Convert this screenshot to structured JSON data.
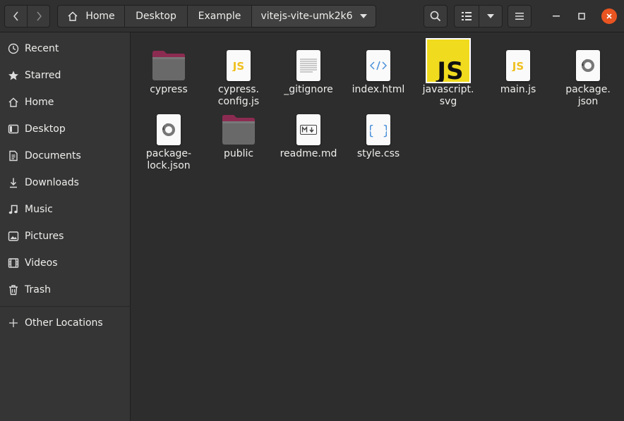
{
  "header": {
    "breadcrumbs": [
      "Home",
      "Desktop",
      "Example",
      "vitejs-vite-umk2k6"
    ]
  },
  "sidebar": {
    "items": [
      {
        "label": "Recent",
        "icon": "clock-icon"
      },
      {
        "label": "Starred",
        "icon": "star-icon"
      },
      {
        "label": "Home",
        "icon": "home-icon"
      },
      {
        "label": "Desktop",
        "icon": "desktop-icon"
      },
      {
        "label": "Documents",
        "icon": "documents-icon"
      },
      {
        "label": "Downloads",
        "icon": "downloads-icon"
      },
      {
        "label": "Music",
        "icon": "music-icon"
      },
      {
        "label": "Pictures",
        "icon": "pictures-icon"
      },
      {
        "label": "Videos",
        "icon": "videos-icon"
      },
      {
        "label": "Trash",
        "icon": "trash-icon"
      }
    ],
    "other_locations": "Other Locations"
  },
  "files": [
    {
      "name": "cypress",
      "type": "folder"
    },
    {
      "name": "cypress.\nconfig.js",
      "type": "js"
    },
    {
      "name": "_gitignore",
      "type": "text"
    },
    {
      "name": "index.html",
      "type": "html"
    },
    {
      "name": "javascript.\nsvg",
      "type": "svg-js",
      "selected": true
    },
    {
      "name": "main.js",
      "type": "js"
    },
    {
      "name": "package.\njson",
      "type": "json"
    },
    {
      "name": "package-\nlock.json",
      "type": "json"
    },
    {
      "name": "public",
      "type": "folder"
    },
    {
      "name": "readme.md",
      "type": "markdown"
    },
    {
      "name": "style.css",
      "type": "css"
    }
  ],
  "colors": {
    "accent": "#e95420",
    "folder": "#7a1f43",
    "js_yellow": "#f0db4f"
  }
}
